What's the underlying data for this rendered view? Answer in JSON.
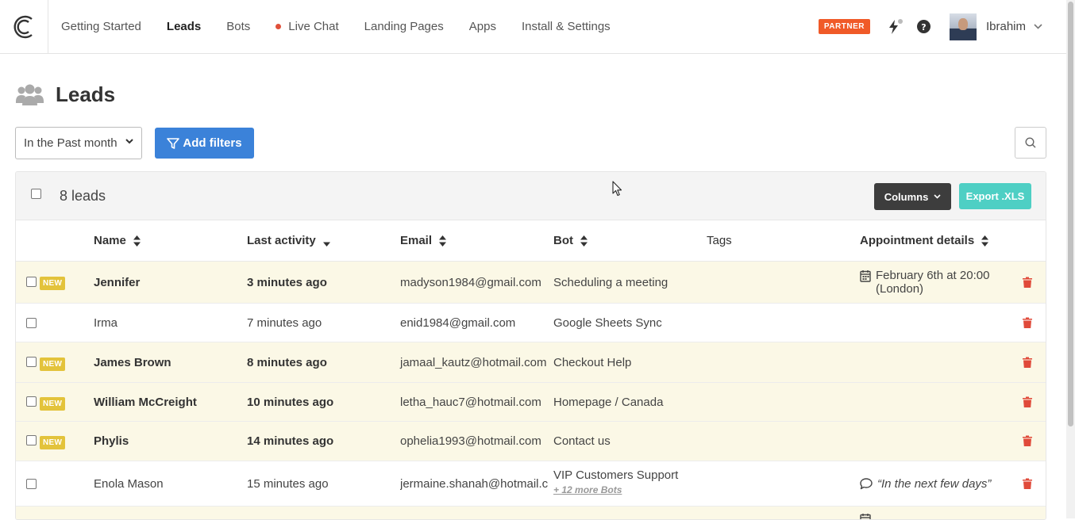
{
  "nav": {
    "links": [
      {
        "label": "Getting Started",
        "active": false
      },
      {
        "label": "Leads",
        "active": true
      },
      {
        "label": "Bots",
        "active": false
      },
      {
        "label": "Live Chat",
        "active": false,
        "dot_color": "#e0503a"
      },
      {
        "label": "Landing Pages",
        "active": false
      },
      {
        "label": "Apps",
        "active": false
      },
      {
        "label": "Install & Settings",
        "active": false
      }
    ],
    "partner_badge": "PARTNER",
    "user_name": "Ibrahim",
    "icons": [
      "logo-icon",
      "bolt-icon",
      "help-icon",
      "chevron-down-icon"
    ]
  },
  "page": {
    "title": "Leads",
    "icon": "users-icon"
  },
  "filters": {
    "range_value": "In the Past month",
    "add_filters_label": "Add filters"
  },
  "toolbar": {
    "count_label": "8 leads",
    "columns_label": "Columns",
    "export_label": "Export .XLS"
  },
  "table": {
    "headers": {
      "name": "Name",
      "last_activity": "Last activity",
      "email": "Email",
      "bot": "Bot",
      "tags": "Tags",
      "appointment": "Appointment details"
    },
    "new_badge": "NEW",
    "rows": [
      {
        "name": "Jennifer",
        "is_new": true,
        "last_activity": "3 minutes ago",
        "email": "madyson1984@gmail.com",
        "bot": "Scheduling a meeting",
        "more_bots": "",
        "tags": "",
        "appointment": "February 6th at 20:00 (London)",
        "appointment_type": "calendar"
      },
      {
        "name": "Irma",
        "is_new": false,
        "last_activity": "7 minutes ago",
        "email": "enid1984@gmail.com",
        "bot": "Google Sheets Sync",
        "more_bots": "",
        "tags": "",
        "appointment": "",
        "appointment_type": ""
      },
      {
        "name": "James Brown",
        "is_new": true,
        "last_activity": "8 minutes ago",
        "email": "jamaal_kautz@hotmail.com",
        "bot": "Checkout Help",
        "more_bots": "",
        "tags": "",
        "appointment": "",
        "appointment_type": ""
      },
      {
        "name": "William McCreight",
        "is_new": true,
        "last_activity": "10 minutes ago",
        "email": "letha_hauc7@hotmail.com",
        "bot": "Homepage / Canada",
        "more_bots": "",
        "tags": "",
        "appointment": "",
        "appointment_type": ""
      },
      {
        "name": "Phylis",
        "is_new": true,
        "last_activity": "14 minutes ago",
        "email": "ophelia1993@hotmail.com",
        "bot": "Contact us",
        "more_bots": "",
        "tags": "",
        "appointment": "",
        "appointment_type": ""
      },
      {
        "name": "Enola Mason",
        "is_new": false,
        "last_activity": "15 minutes ago",
        "email": "jermaine.shanah@hotmail.c",
        "bot": "VIP Customers Support",
        "more_bots": "+ 12 more Bots",
        "tags": "",
        "appointment": "“In the next few days”",
        "appointment_type": "comment"
      }
    ]
  },
  "colors": {
    "primary": "#3b82d9",
    "export": "#4ecfc4",
    "partner": "#f05a28",
    "new_badge": "#e3c33b",
    "new_row": "#fbf8e6",
    "trash": "#e04a3a"
  }
}
